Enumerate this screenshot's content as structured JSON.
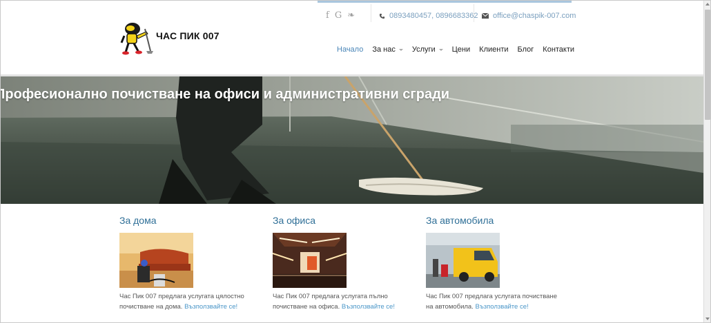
{
  "brand": {
    "name": "ЧАС ПИК 007"
  },
  "social": {
    "facebook": "f",
    "google": "G",
    "twitter": "❧"
  },
  "contact": {
    "phone_icon": "phone-icon",
    "phones": "0893480457, 0896683362",
    "email_icon": "envelope-icon",
    "email": "office@chaspik-007.com"
  },
  "nav": {
    "items": [
      {
        "label": "Начало"
      },
      {
        "label": "За нас"
      },
      {
        "label": "Услуги"
      },
      {
        "label": "Цени"
      },
      {
        "label": "Клиенти"
      },
      {
        "label": "Блог"
      },
      {
        "label": "Контакти"
      }
    ]
  },
  "hero": {
    "title": "Професионално почистване на офиси и административни сгради"
  },
  "cards": [
    {
      "title": "За дома",
      "text": "Час Пик 007 предлага услугата цялостно почистване на дома.",
      "link": "Възползвайте се!"
    },
    {
      "title": "За офиса",
      "text": "Час Пик 007 предлага услугата пълно почистване на офиса.",
      "link": "Възползвайте се!"
    },
    {
      "title": "За автомобила",
      "text": "Час Пик 007 предлага услугата почистване на автомобила.",
      "link": "Възползвайте се!"
    }
  ],
  "colors": {
    "accent": "#4a86b8",
    "heading": "#2f6f97",
    "link": "#4a96c8",
    "top_bar": "#a9c6de"
  }
}
